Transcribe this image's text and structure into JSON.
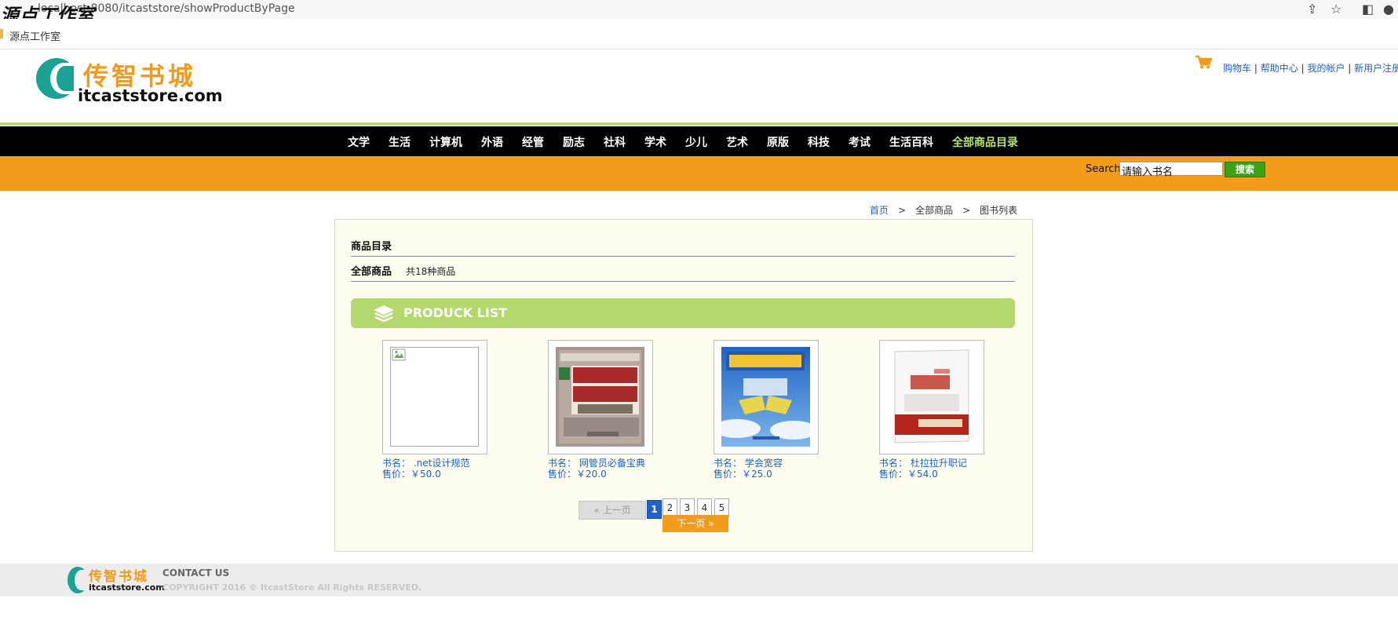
{
  "browser": {
    "url": "localhost:8080/itcaststore/showProductByPage",
    "watermark": "源点工作室",
    "bookmark_folder": "源点工作室"
  },
  "site": {
    "logo_cn": "传智书城",
    "logo_en": "itcaststore.com"
  },
  "toplinks": {
    "cart": "购物车",
    "help": "帮助中心",
    "account": "我的帐户",
    "register": "新用户注册",
    "sep": "|"
  },
  "nav": {
    "items": [
      "文学",
      "生活",
      "计算机",
      "外语",
      "经管",
      "励志",
      "社科",
      "学术",
      "少儿",
      "艺术",
      "原版",
      "科技",
      "考试",
      "生活百科"
    ],
    "all": "全部商品目录",
    "highlight_color": "#b7e36c"
  },
  "search": {
    "label": "Search",
    "value": "请输入书名",
    "button": "搜索"
  },
  "breadcrumb": {
    "home": "首页",
    "sep": ">",
    "level2": "全部商品",
    "level3": "图书列表"
  },
  "catalog": {
    "title": "商品目录",
    "all_label": "全部商品",
    "count": "共18种商品",
    "list_banner": "PRODUCK LIST"
  },
  "products": [
    {
      "name_label": "书名：",
      "name": ".net设计规范",
      "price_label": "售价：",
      "price": "￥50.0",
      "cover": "broken-image"
    },
    {
      "name_label": "书名：",
      "name": "网管员必备宝典",
      "price_label": "售价：",
      "price": "￥20.0",
      "cover": "network-admin-book"
    },
    {
      "name_label": "书名：",
      "name": "学会宽容",
      "price_label": "售价：",
      "price": "￥25.0",
      "cover": "learn-tolerance-book"
    },
    {
      "name_label": "书名：",
      "name": "杜拉拉升职记",
      "price_label": "售价：",
      "price": "￥54.0",
      "cover": "dulala-book"
    }
  ],
  "pager": {
    "prev": "上一页",
    "next": "下一页",
    "pages": [
      "1",
      "2",
      "3",
      "4",
      "5"
    ],
    "current": "1"
  },
  "footer": {
    "contact": "CONTACT US",
    "copyright": "COPYRIGHT 2016 © ItcastStore All Rights RESERVED."
  },
  "colors": {
    "brand_orange": "#f39c1b",
    "brand_green": "#b3d86e",
    "teal": "#1aa394",
    "link_blue": "#1f62c9"
  }
}
